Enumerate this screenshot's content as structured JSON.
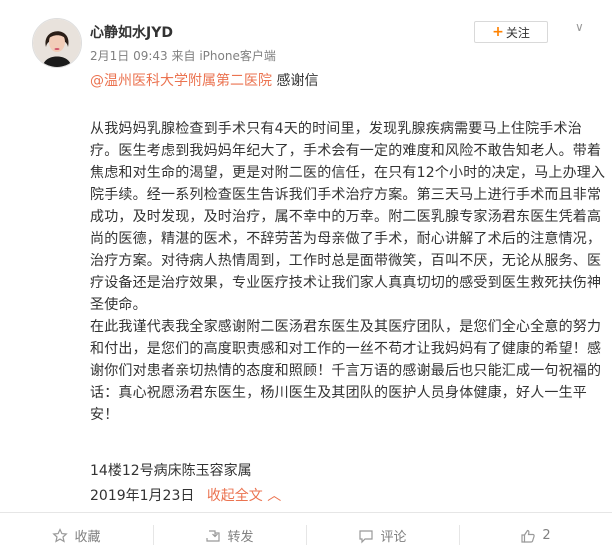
{
  "post": {
    "username": "心静如水JYD",
    "time": "2月1日 09:43",
    "source_prefix": "来自",
    "source": "iPhone客户端",
    "follow_label": "关注",
    "mention": "@温州医科大学附属第二医院",
    "mention_suffix": " 感谢信",
    "paragraphs": [
      "从我妈妈乳腺检查到手术只有4天的时间里，发现乳腺疾病需要马上住院手术治疗。医生考虑到我妈妈年纪大了，手术会有一定的难度和风险不敢告知老人。带着焦虑和对生命的渴望，更是对附二医的信任，在只有12个小时的决定，马上办理入院手续。经一系列检查医生告诉我们手术治疗方案。第三天马上进行手术而且非常成功，及时发现，及时治疗，属不幸中的万幸。附二医乳腺专家汤君东医生凭着高尚的医德，精湛的医术，不辞劳苦为母亲做了手术，耐心讲解了术后的注意情况，治疗方案。对待病人热情周到，工作时总是面带微笑，百叫不厌，无论从服务、医疗设备还是治疗效果，专业医疗技术让我们家人真真切切的感受到医生救死扶伤神圣使命。",
      "在此我谨代表我全家感谢附二医汤君东医生及其医疗团队，是您们全心全意的努力和付出，是您们的高度职责感和对工作的一丝不苟才让我妈妈有了健康的希望！感谢你们对患者亲切热情的态度和照顾！千言万语的感谢最后也只能汇成一句祝福的话：真心祝愿汤君东医生，杨川医生及其团队的医护人员身体健康，好人一生平安！"
    ],
    "signature": "14楼12号病床陈玉容家属",
    "date": "2019年1月23日",
    "collapse_label": "收起全文",
    "collapse_icon": "chevron-up-icon"
  },
  "actions": {
    "favorite_label": "收藏",
    "repost_label": "转发",
    "comment_label": "评论",
    "like_count": "2"
  },
  "colors": {
    "accent": "#eb7350",
    "follow_plus": "#ff8200",
    "meta": "#808080"
  }
}
